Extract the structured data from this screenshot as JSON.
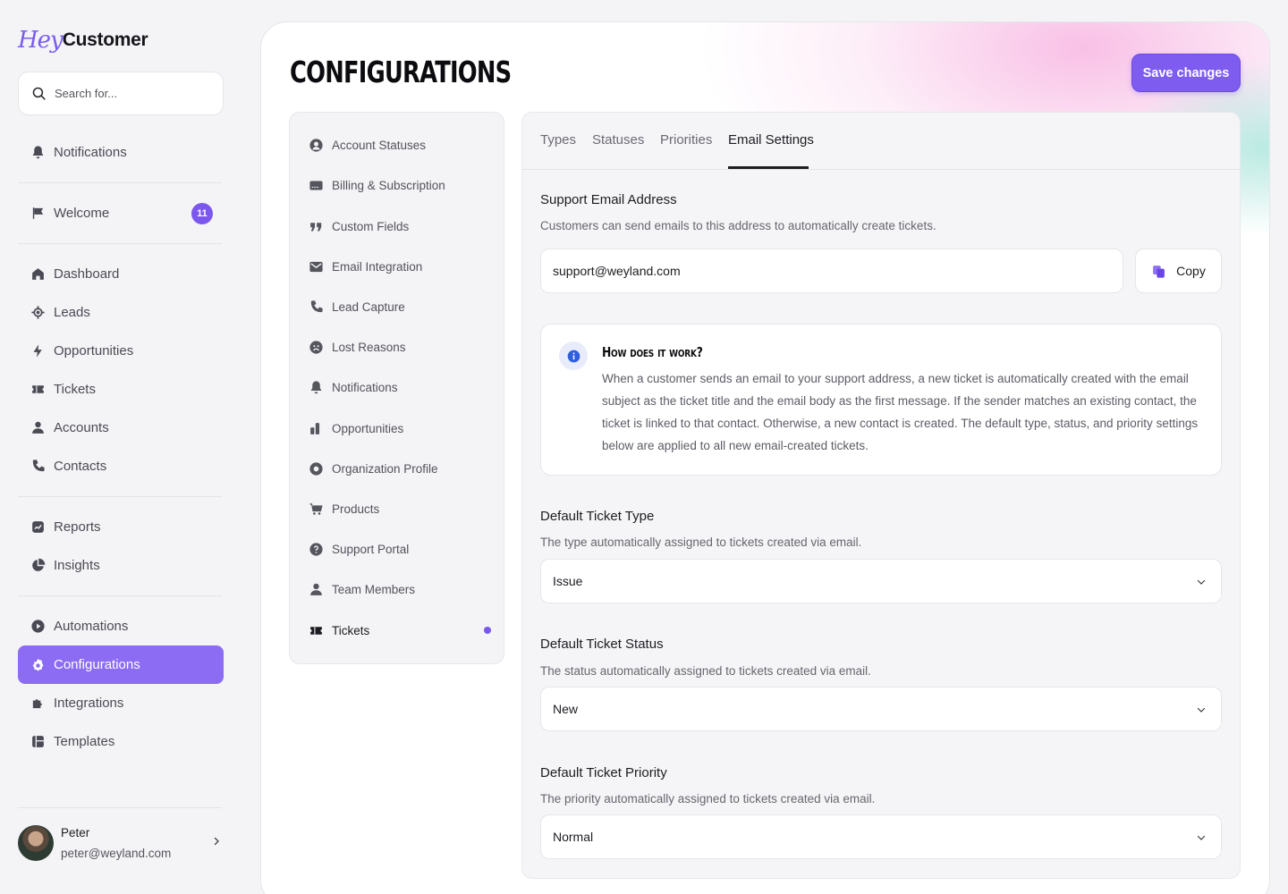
{
  "brand": {
    "logo_hey": "Hey",
    "logo_customer": "Customer"
  },
  "search": {
    "placeholder": "Search for..."
  },
  "sidebar": {
    "notifications": "Notifications",
    "welcome": "Welcome",
    "welcome_badge": "11",
    "items": {
      "dashboard": "Dashboard",
      "leads": "Leads",
      "opportunities": "Opportunities",
      "tickets": "Tickets",
      "accounts": "Accounts",
      "contacts": "Contacts",
      "reports": "Reports",
      "insights": "Insights",
      "automations": "Automations",
      "configurations": "Configurations",
      "integrations": "Integrations",
      "templates": "Templates"
    },
    "active": "configurations"
  },
  "user": {
    "name": "Peter",
    "email": "peter@weyland.com"
  },
  "page": {
    "title": "CONFIGURATIONS",
    "save_label": "Save changes"
  },
  "settings_menu": {
    "account_statuses": "Account Statuses",
    "billing": "Billing & Subscription",
    "custom_fields": "Custom Fields",
    "email_integration": "Email Integration",
    "lead_capture": "Lead Capture",
    "lost_reasons": "Lost Reasons",
    "notifications": "Notifications",
    "opportunities": "Opportunities",
    "organization_profile": "Organization Profile",
    "products": "Products",
    "support_portal": "Support Portal",
    "team_members": "Team Members",
    "tickets": "Tickets",
    "current": "tickets"
  },
  "tabs": {
    "types": "Types",
    "statuses": "Statuses",
    "priorities": "Priorities",
    "email_settings": "Email Settings",
    "active": "email_settings"
  },
  "support_email": {
    "title": "Support Email Address",
    "description": "Customers can send emails to this address to automatically create tickets.",
    "value": "support@weyland.com",
    "copy_label": "Copy"
  },
  "info": {
    "title": "How does it work?",
    "body": "When a customer sends an email to your support address, a new ticket is automatically created with the email subject as the ticket title and the email body as the first message. If the sender matches an existing contact, the ticket is linked to that contact. Otherwise, a new contact is created. The default type, status, and priority settings below are applied to all new email-created tickets."
  },
  "default_type": {
    "title": "Default Ticket Type",
    "description": "The type automatically assigned to tickets created via email.",
    "value": "Issue"
  },
  "default_status": {
    "title": "Default Ticket Status",
    "description": "The status automatically assigned to tickets created via email.",
    "value": "New"
  },
  "default_priority": {
    "title": "Default Ticket Priority",
    "description": "The priority automatically assigned to tickets created via email.",
    "value": "Normal"
  },
  "colors": {
    "accent": "#7e5cf0",
    "active_nav": "#8b6cf2"
  }
}
